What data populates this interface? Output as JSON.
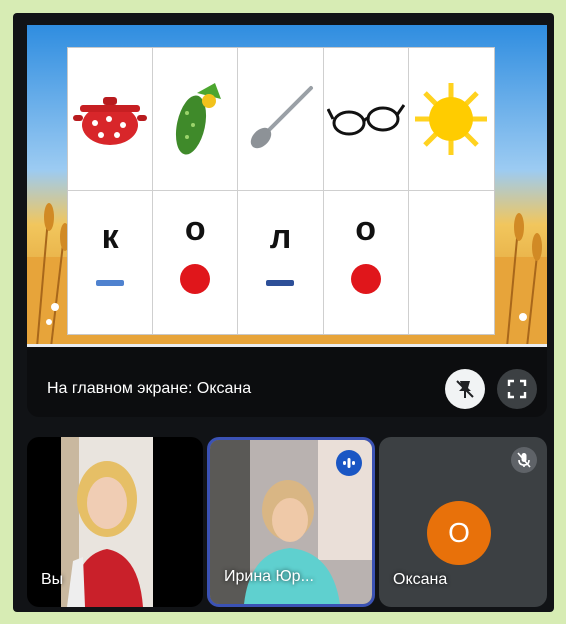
{
  "shared_screen": {
    "letters": [
      "к",
      "о",
      "л",
      "о"
    ],
    "pictures": [
      "pot-icon",
      "cucumber-icon",
      "spoon-icon",
      "glasses-icon",
      "sun-icon"
    ],
    "marks": [
      "blue-dash",
      "red-dot",
      "blue-dash",
      "red-dot"
    ]
  },
  "caption": {
    "text": "На главном экране: Оксана"
  },
  "tiles": {
    "self_label": "Вы",
    "second_label": "Ирина Юр...",
    "third_label": "Оксана",
    "third_initial": "О"
  },
  "colors": {
    "accent_blue": "#1a56c4",
    "red": "#e0161b",
    "avatar_orange": "#e8710a",
    "dash_blue": "#3b5fa6"
  }
}
